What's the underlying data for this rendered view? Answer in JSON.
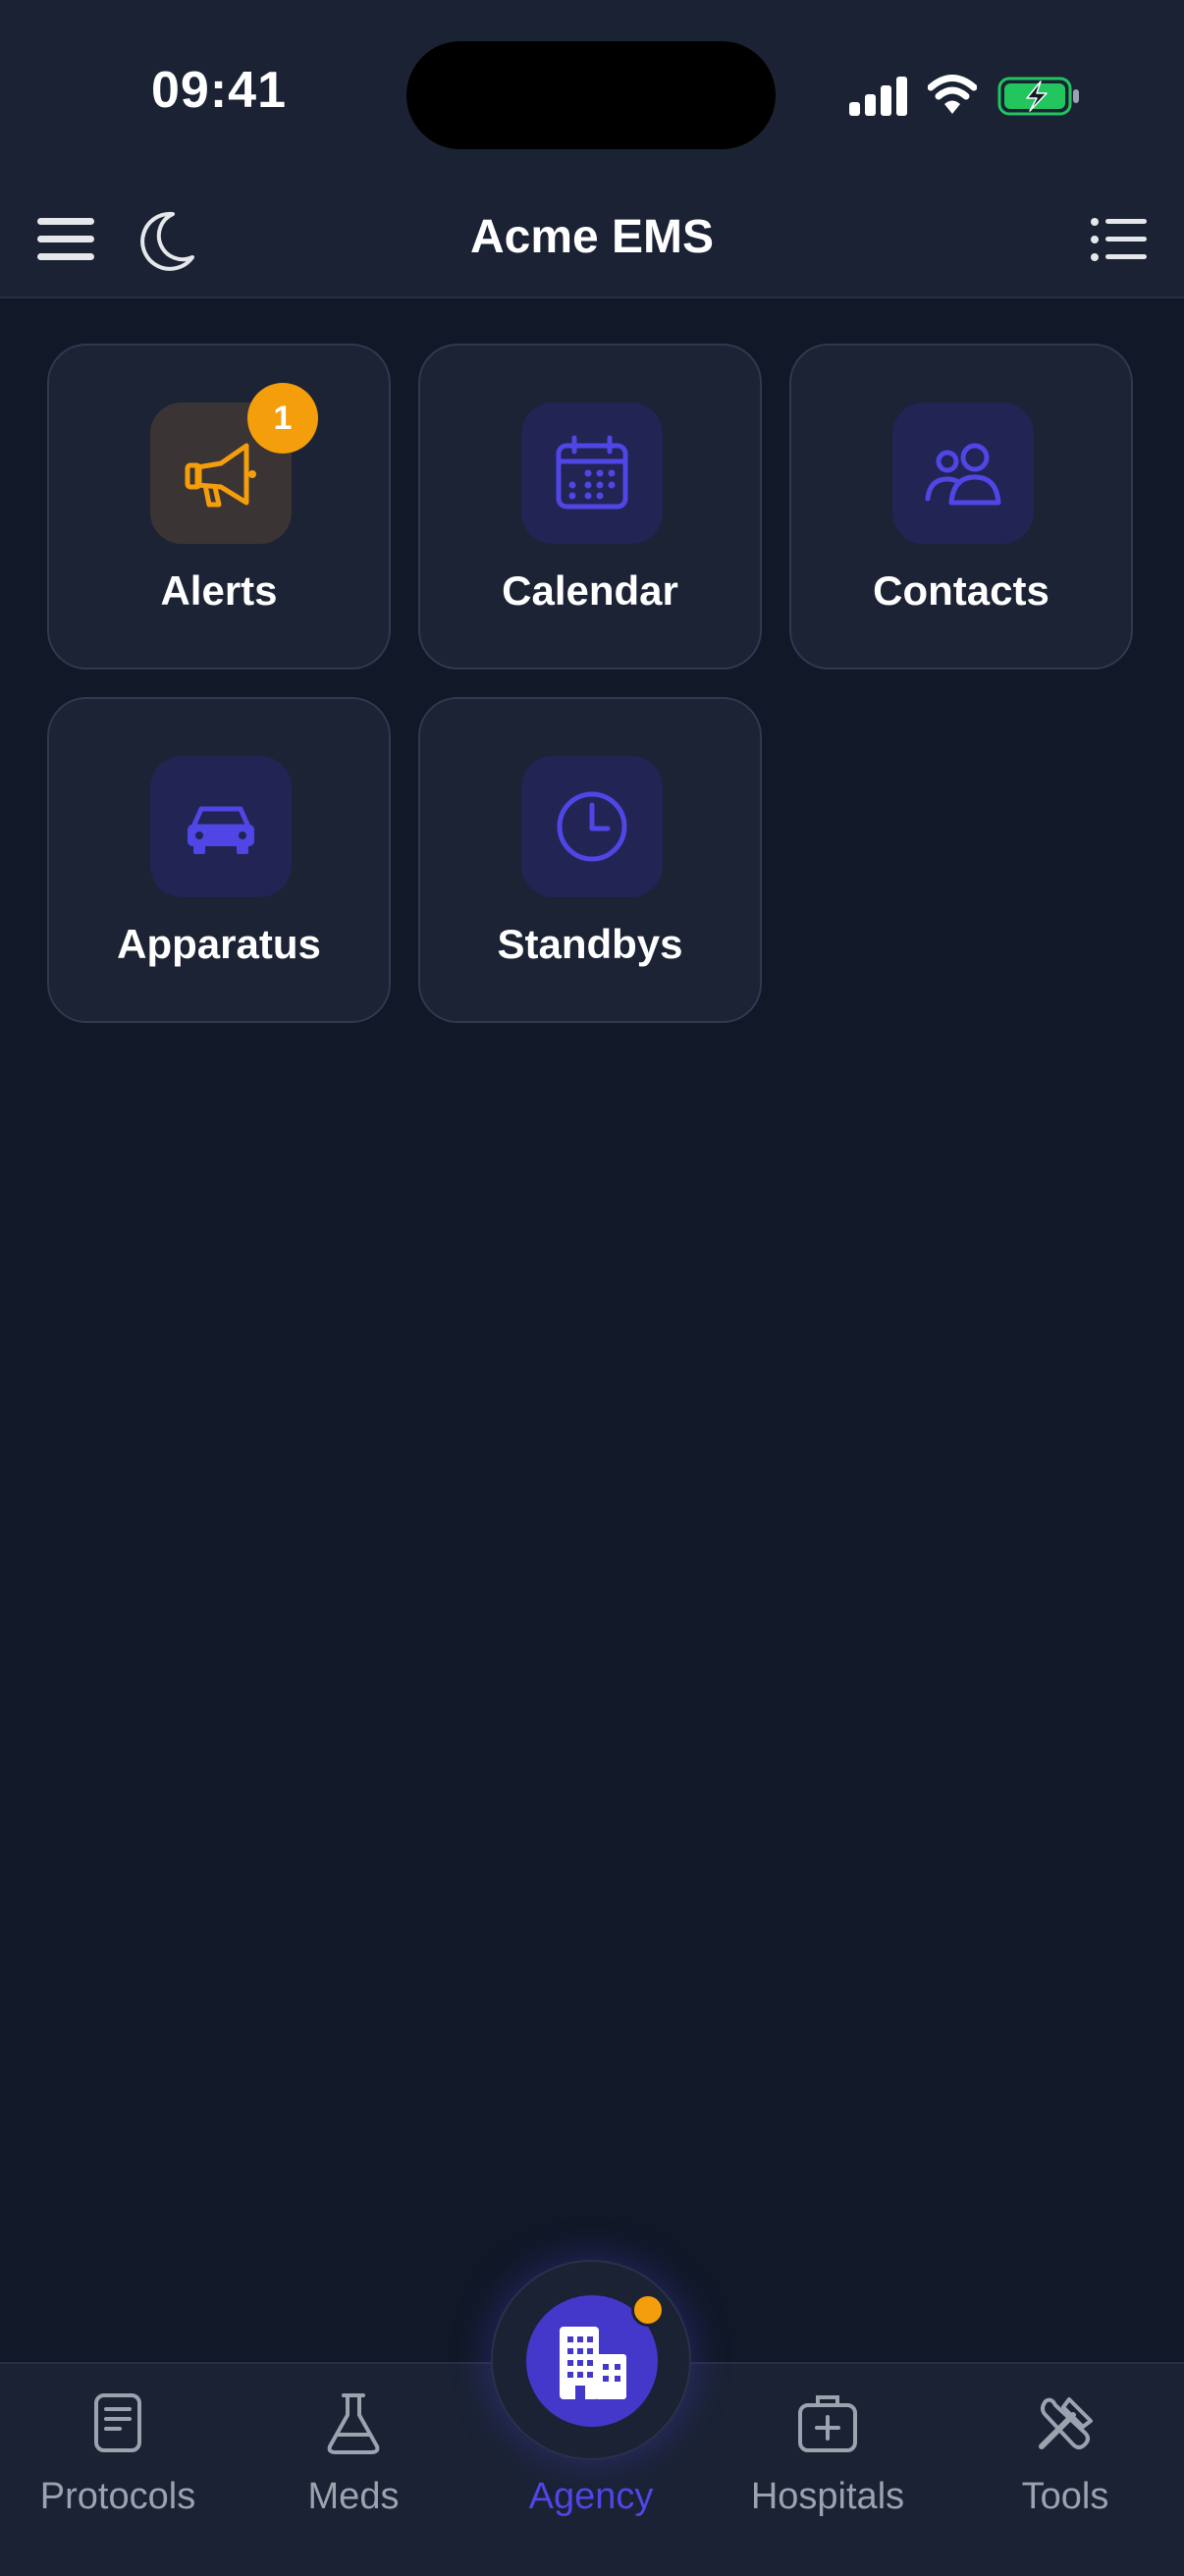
{
  "status_bar": {
    "time": "09:41",
    "icons": [
      "cellular-signal-icon",
      "wifi-icon",
      "battery-charging-icon"
    ]
  },
  "header": {
    "title": "Acme EMS",
    "left_icons": [
      "hamburger-menu-icon",
      "moon-icon"
    ],
    "right_icon": "list-icon"
  },
  "tiles": [
    {
      "label": "Alerts",
      "icon": "megaphone-icon",
      "badge": "1",
      "accent": "#f59e0b"
    },
    {
      "label": "Calendar",
      "icon": "calendar-icon",
      "accent": "#4f46e5"
    },
    {
      "label": "Contacts",
      "icon": "users-icon",
      "accent": "#4f46e5"
    },
    {
      "label": "Apparatus",
      "icon": "car-icon",
      "accent": "#4f46e5"
    },
    {
      "label": "Standbys",
      "icon": "clock-icon",
      "accent": "#4f46e5"
    }
  ],
  "tabbar": {
    "items": [
      {
        "label": "Protocols",
        "icon": "document-icon"
      },
      {
        "label": "Meds",
        "icon": "flask-icon"
      },
      {
        "label": "Agency",
        "icon": "building-icon",
        "active": true
      },
      {
        "label": "Hospitals",
        "icon": "medical-kit-icon"
      },
      {
        "label": "Tools",
        "icon": "tools-icon"
      }
    ]
  },
  "colors": {
    "background": "#111827",
    "surface": "#1b2335",
    "accent": "#4f46e5",
    "warning": "#f59e0b",
    "battery_charge": "#22c55e"
  }
}
